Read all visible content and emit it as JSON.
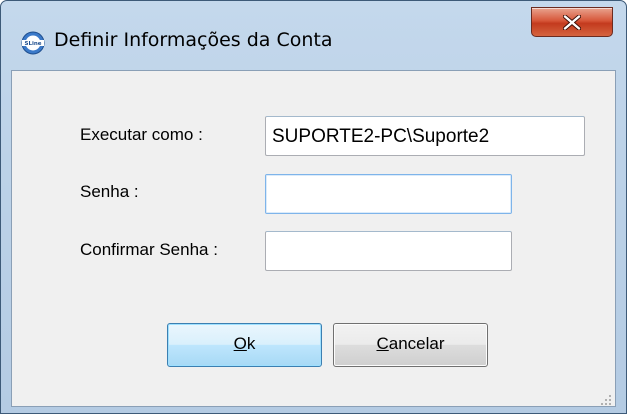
{
  "window": {
    "title": "Definir Informações da Conta",
    "icon": "sline-app-icon",
    "close_icon": "close-icon"
  },
  "form": {
    "run_as_label": "Executar como :",
    "run_as_value": "SUPORTE2-PC\\Suporte2",
    "password_label": "Senha :",
    "password_value": "",
    "confirm_label": "Confirmar Senha :",
    "confirm_value": ""
  },
  "buttons": {
    "ok": {
      "mnemonic": "O",
      "rest": "k"
    },
    "cancel": {
      "mnemonic": "C",
      "rest": "ancelar"
    }
  },
  "colors": {
    "close_button": "#c9442a",
    "default_button_border": "#3c7fb1",
    "focused_field_border": "#7eb4ea"
  }
}
